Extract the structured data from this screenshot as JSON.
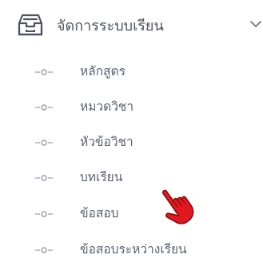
{
  "menu": {
    "icon": "inbox-icon",
    "title": "จัดการระบบเรียน",
    "expanded": true,
    "items": [
      {
        "label": "หลักสูตร"
      },
      {
        "label": "หมวดวิชา"
      },
      {
        "label": "หัวข้อวิชา"
      },
      {
        "label": "บทเรียน"
      },
      {
        "label": "ข้อสอบ"
      },
      {
        "label": "ข้อสอบระหว่างเรียน"
      }
    ]
  },
  "colors": {
    "text": "#4e5160",
    "subtext": "#5f6270",
    "bullet": "#9a9ca8",
    "cursor": "#e0191f"
  }
}
